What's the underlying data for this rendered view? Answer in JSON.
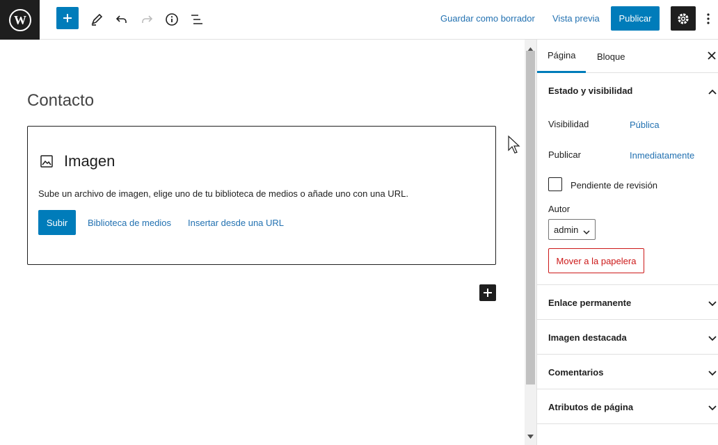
{
  "toolbar": {
    "save_draft": "Guardar como borrador",
    "preview": "Vista previa",
    "publish": "Publicar"
  },
  "editor": {
    "post_title": "Contacto",
    "image_block": {
      "title": "Imagen",
      "description": "Sube un archivo de imagen, elige uno de tu biblioteca de medios o añade uno con una URL.",
      "upload": "Subir",
      "media_library": "Biblioteca de medios",
      "insert_url": "Insertar desde una URL"
    }
  },
  "sidebar": {
    "tabs": [
      {
        "label": "Página",
        "active": true
      },
      {
        "label": "Bloque",
        "active": false
      }
    ],
    "status_panel": {
      "title": "Estado y visibilidad",
      "visibility_label": "Visibilidad",
      "visibility_value": "Pública",
      "publish_label": "Publicar",
      "publish_value": "Inmediatamente",
      "pending_review": "Pendiente de revisión",
      "author_label": "Autor",
      "author_value": "admin",
      "trash": "Mover a la papelera"
    },
    "panels": [
      {
        "title": "Enlace permanente"
      },
      {
        "title": "Imagen destacada"
      },
      {
        "title": "Comentarios"
      },
      {
        "title": "Atributos de página"
      }
    ]
  },
  "colors": {
    "accent": "#007cba",
    "link": "#2271b1",
    "dark": "#1e1e1e",
    "danger": "#cc1818"
  }
}
